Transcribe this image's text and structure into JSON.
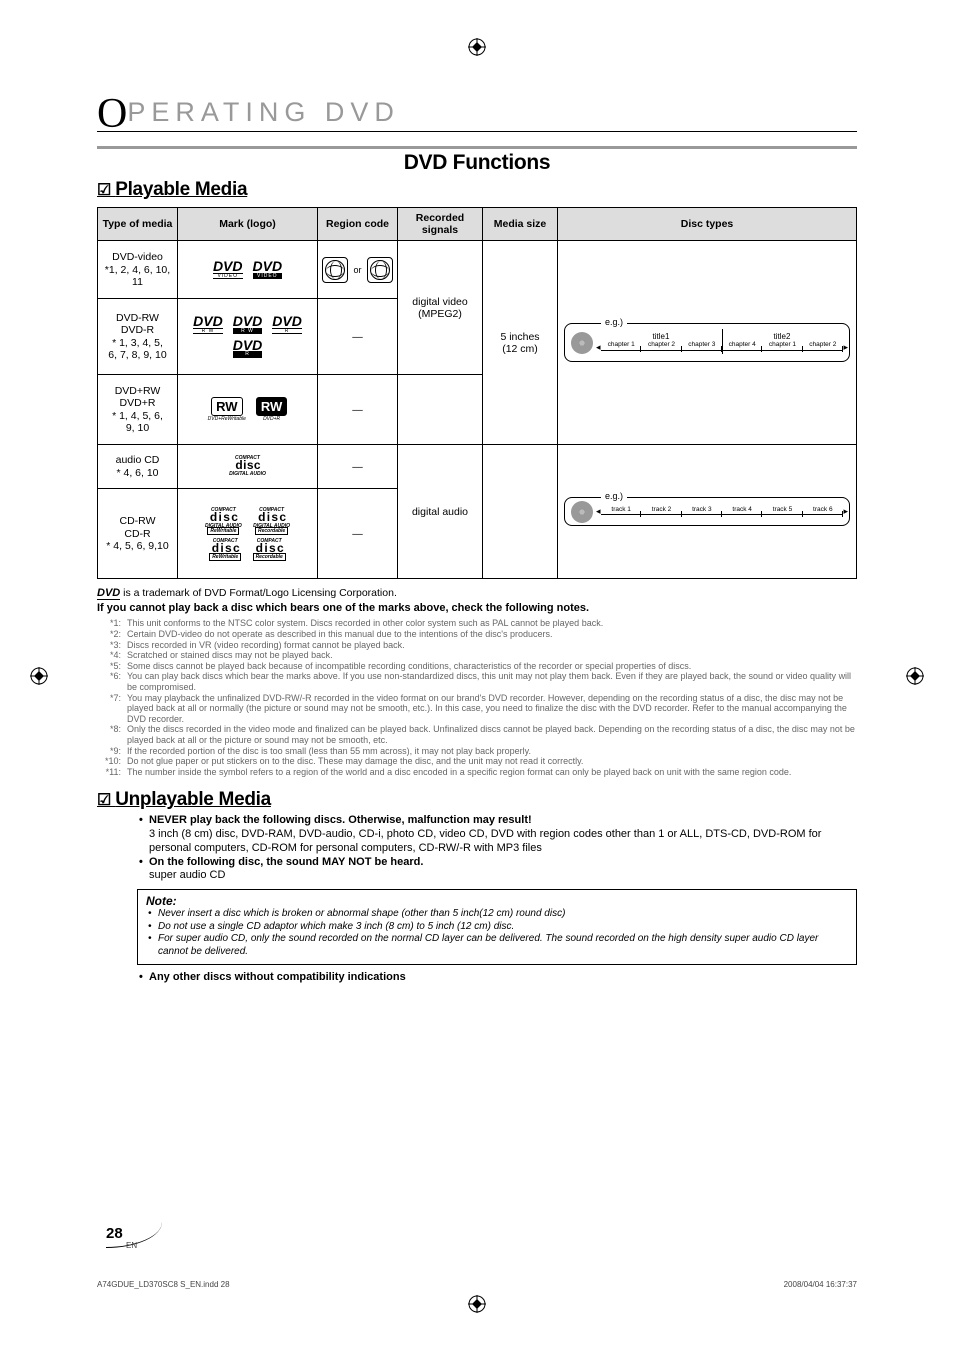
{
  "chapter_prefix": "O",
  "chapter_rest": "PERATING  DVD",
  "function_title": "DVD Functions",
  "playable_heading": "Playable Media",
  "unplayable_heading": "Unplayable Media",
  "table_headers": {
    "type": "Type of media",
    "mark": "Mark (logo)",
    "region": "Region code",
    "signals": "Recorded signals",
    "size": "Media size",
    "disc_types": "Disc types"
  },
  "rows": {
    "dvd_video": {
      "name": "DVD-video",
      "note": "*1, 2, 4, 6, 10, 11"
    },
    "dvd_rw_r": {
      "name1": "DVD-RW",
      "name2": "DVD-R",
      "note1": "* 1, 3, 4, 5,",
      "note2": "6, 7, 8, 9, 10"
    },
    "dvd_prw_pr": {
      "name1": "DVD+RW",
      "name2": "DVD+R",
      "note1": "* 1, 4, 5, 6,",
      "note2": "9, 10"
    },
    "audio_cd": {
      "name": "audio CD",
      "note": "* 4, 6, 10"
    },
    "cd_rw_r": {
      "name1": "CD-RW",
      "name2": "CD-R",
      "note": "* 4, 5, 6, 9,10"
    }
  },
  "logos": {
    "dvd_video": "VIDEO",
    "dvd_rw": "R W",
    "dvd_r": "R",
    "rw_box": "RW",
    "rw_rewrite": "DVD+ReWritable",
    "rw_plus": "DVD+R",
    "compact": "COMPACT",
    "digital_audio": "DIGITAL AUDIO",
    "rewritable": "ReWritable",
    "recordable": "Recordable"
  },
  "region_or": "or",
  "dash": "—",
  "recorded": {
    "digital_video": "digital video",
    "mpeg2": "(MPEG2)",
    "digital_audio": "digital audio"
  },
  "size": {
    "five": "5 inches",
    "cm": "(12 cm)"
  },
  "disc_eg": {
    "label": "e.g.)"
  },
  "disc_eg_video": {
    "title1": "title1",
    "title2": "title2",
    "chapters": [
      "chapter 1",
      "chapter 2",
      "chapter 3",
      "chapter 4",
      "chapter 1",
      "chapter 2"
    ]
  },
  "disc_eg_audio": {
    "tracks": [
      "track 1",
      "track 2",
      "track 3",
      "track 4",
      "track 5",
      "track 6"
    ]
  },
  "trademark_text": " is a trademark of DVD Format/Logo Licensing Corporation.",
  "bold_note": "If you cannot play back a disc which bears one of the marks above, check the following notes.",
  "footnotes": [
    {
      "n": "*1:",
      "t": "This unit conforms to the NTSC color system. Discs recorded in other color system such as PAL cannot be played back."
    },
    {
      "n": "*2:",
      "t": "Certain DVD-video do not operate as described in this manual due to the intentions of the disc's producers."
    },
    {
      "n": "*3:",
      "t": "Discs recorded in VR (video recording) format cannot be played back."
    },
    {
      "n": "*4:",
      "t": "Scratched or stained discs may not be played back."
    },
    {
      "n": "*5:",
      "t": "Some discs cannot be played back because of incompatible recording conditions, characteristics of the recorder or special properties of discs."
    },
    {
      "n": "*6:",
      "t": "You can play back discs which bear the marks above. If you use non-standardized discs, this unit may not play them back. Even if they are played back, the sound or video quality will be compromised."
    },
    {
      "n": "*7:",
      "t": "You may playback the unfinalized DVD-RW/-R recorded in the video format on our brand's DVD recorder. However, depending on the recording status of a disc, the disc may not be played back at all or normally (the picture or sound may not be smooth, etc.). In this case, you need to finalize the disc with the DVD recorder. Refer to the manual accompanying the DVD recorder."
    },
    {
      "n": "*8:",
      "t": "Only the discs recorded in the video mode and finalized can be played back. Unfinalized discs cannot be played back. Depending on the recording status of a disc, the disc may not be played back at all or the picture or sound may not be smooth, etc."
    },
    {
      "n": "*9:",
      "t": "If the recorded portion of the disc is too small (less than 55 mm across), it may not play back properly."
    },
    {
      "n": "*10:",
      "t": "Do not glue paper or put stickers on to the disc. These may damage the disc, and the unit may not read it correctly."
    },
    {
      "n": "*11:",
      "t": "The number inside the symbol refers to a region of the world and a disc encoded in a specific region format can only be played back on unit with the same region code."
    }
  ],
  "unplayable_items": [
    {
      "b": "NEVER play back the following discs. Otherwise, malfunction may result!",
      "t": "3 inch (8 cm) disc, DVD-RAM, DVD-audio, CD-i, photo CD, video CD, DVD with region codes other than 1 or ALL, DTS-CD, DVD-ROM for personal computers, CD-ROM for personal computers, CD-RW/-R with MP3 files"
    },
    {
      "b": "On the following disc, the sound MAY NOT be heard.",
      "t": "super audio CD"
    }
  ],
  "note_title": "Note:",
  "note_items": [
    "Never insert a disc which is broken or abnormal shape (other than 5 inch(12 cm) round disc)",
    "Do not use a single CD adaptor which make 3 inch (8 cm) to 5 inch (12 cm) disc.",
    "For super audio CD, only the sound recorded on the normal CD layer can be delivered. The sound recorded on the high density super audio CD layer cannot be delivered."
  ],
  "final_bullet": "Any other discs without compatibility indications",
  "page_number": "28",
  "page_lang": "EN",
  "footer_left": "A74GDUE_LD370SC8 S_EN.indd   28",
  "footer_right": "2008/04/04   16:37:37"
}
